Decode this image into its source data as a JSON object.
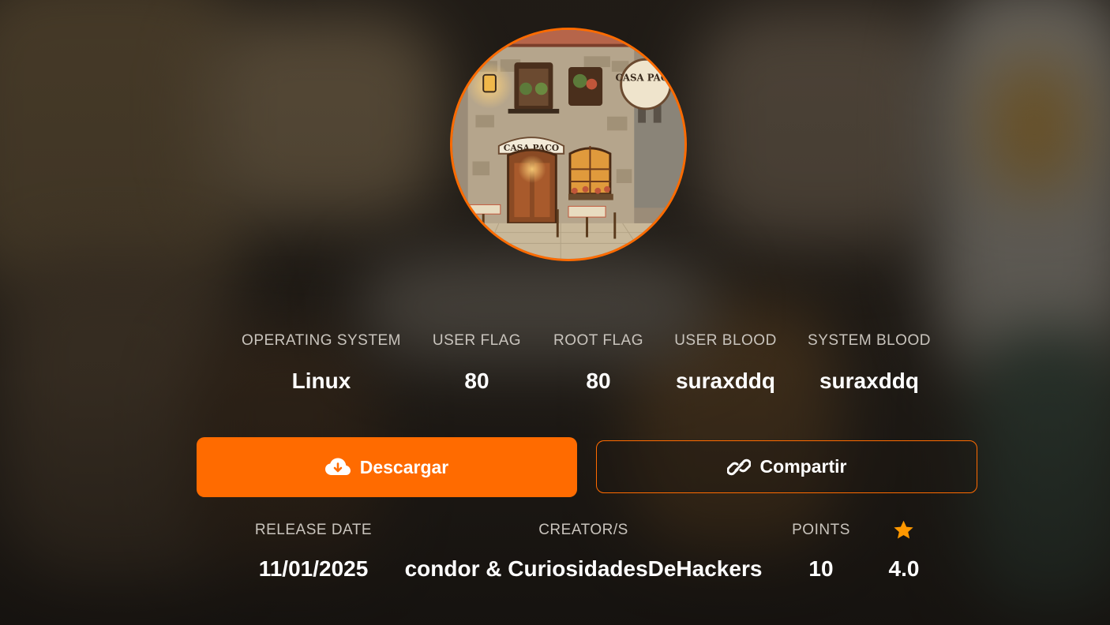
{
  "machine_image": {
    "sign_main": "CASA PACO",
    "sign_round": "CASA PACO"
  },
  "stats": [
    {
      "label": "OPERATING SYSTEM",
      "value": "Linux"
    },
    {
      "label": "USER FLAG",
      "value": "80"
    },
    {
      "label": "ROOT FLAG",
      "value": "80"
    },
    {
      "label": "USER BLOOD",
      "value": "suraxddq"
    },
    {
      "label": "SYSTEM BLOOD",
      "value": "suraxddq"
    }
  ],
  "actions": {
    "download_label": "Descargar",
    "download_icon": "cloud-download-icon",
    "share_label": "Compartir",
    "share_icon": "link-icon"
  },
  "meta": {
    "release_date_label": "RELEASE DATE",
    "release_date": "11/01/2025",
    "creators_label": "CREATOR/S",
    "creators": "condor & CuriosidadesDeHackers",
    "points_label": "POINTS",
    "points": "10",
    "rating_icon": "star-icon",
    "rating": "4.0"
  },
  "colors": {
    "accent": "#ff6b00",
    "label": "#c9c4bd",
    "value": "#ffffff",
    "star": "#ff9800"
  }
}
